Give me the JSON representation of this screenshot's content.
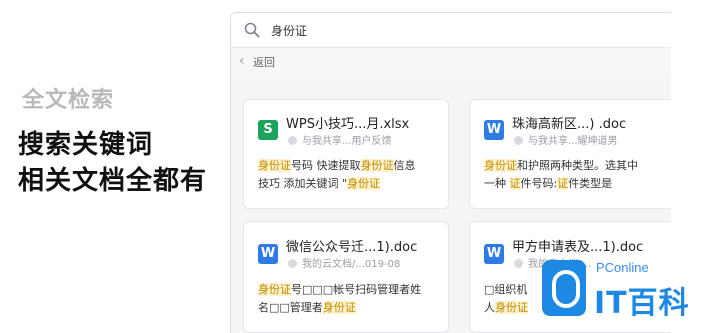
{
  "left": {
    "feature_title": "全文检索",
    "headline_line1": "搜索关键词",
    "headline_line2": "相关文档全都有"
  },
  "search": {
    "query": "身份证"
  },
  "nav": {
    "back_label": "返回"
  },
  "cards": [
    {
      "file_type": "xlsx",
      "icon_letter": "S",
      "icon_color": "#1aa35d",
      "name": "WPS小技巧...月.xlsx",
      "meta": "与我共享...用户反馈",
      "snippet_line1": [
        [
          "身份证",
          "h"
        ],
        [
          "号码 快速提取",
          ""
        ],
        [
          "身份证",
          "h"
        ],
        [
          "信息",
          ""
        ]
      ],
      "snippet_line2": [
        [
          "技巧 添加关键词 \"",
          ""
        ],
        [
          "身份证",
          "h"
        ]
      ]
    },
    {
      "file_type": "doc",
      "icon_letter": "W",
      "icon_color": "#2f7ae5",
      "name": "珠海高新区...) .doc",
      "meta": "与我共享...耀坤道男",
      "snippet_line1": [
        [
          "身份证",
          "h"
        ],
        [
          "和护照两种类型。选其中",
          ""
        ]
      ],
      "snippet_line2": [
        [
          "一种 ",
          ""
        ],
        [
          "证",
          "h"
        ],
        [
          "件号码:",
          ""
        ],
        [
          "证",
          "h"
        ],
        [
          "件类型是",
          ""
        ]
      ]
    },
    {
      "file_type": "doc",
      "icon_letter": "W",
      "icon_color": "#2f7ae5",
      "name": "微信公众号迁...1).doc",
      "meta": "我的云文档/...019-08",
      "snippet_line1": [
        [
          "身份证",
          "h"
        ],
        [
          "号□□□帐号扫码管理者姓",
          ""
        ]
      ],
      "snippet_line2": [
        [
          "名□□管理者",
          ""
        ],
        [
          "身份证",
          "h"
        ]
      ]
    },
    {
      "file_type": "doc",
      "icon_letter": "W",
      "icon_color": "#2f7ae5",
      "name": "甲方申请表及...1).doc",
      "meta": "我的云文档/...",
      "snippet_line1": [
        [
          "□组织机",
          ""
        ]
      ],
      "snippet_line2": [
        [
          "人",
          ""
        ],
        [
          "身份证",
          "h"
        ]
      ]
    }
  ],
  "watermark": {
    "brand_en": "PConline",
    "brand_cn": "IT百科"
  }
}
